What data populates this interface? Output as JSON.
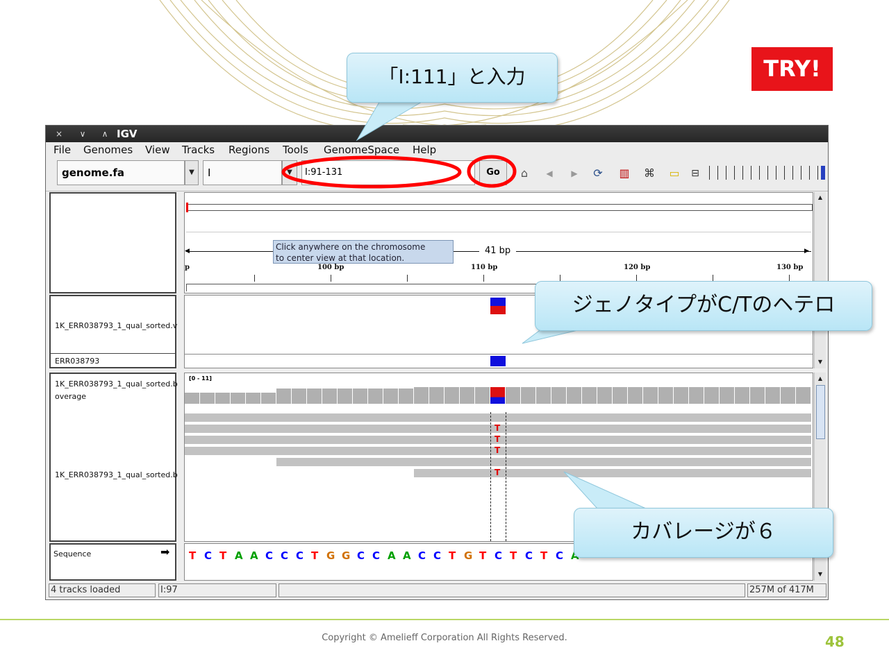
{
  "try_badge": "TRY!",
  "callouts": {
    "enter_locus": "「I:111」と入力",
    "genotype": "ジェノタイプがC/Tのヘテロ",
    "coverage": "カバレージが６"
  },
  "window": {
    "title": "IGV",
    "controls": [
      "×",
      "∨",
      "∧"
    ]
  },
  "menu": [
    "File",
    "Genomes",
    "View",
    "Tracks",
    "Regions",
    "Tools",
    "GenomeSpace",
    "Help"
  ],
  "toolbar": {
    "genome": "genome.fa",
    "chromosome": "I",
    "locus": "I:91-131",
    "go": "Go",
    "icons": [
      "home-icon",
      "back-icon",
      "forward-icon",
      "refresh-icon",
      "region-icon",
      "resize-icon",
      "popup-info-icon",
      "zoom-out-icon"
    ]
  },
  "ruler": {
    "tooltip_line1": "Click anywhere on the chromosome",
    "tooltip_line2": "to center view at that location.",
    "span": "41 bp",
    "edge_label": "p",
    "ticks": [
      "100 bp",
      "110 bp",
      "120 bp",
      "130 bp"
    ]
  },
  "tracks": {
    "vcf_name": "1K_ERR038793_1_qual_sorted.v",
    "sample_name": "ERR038793",
    "coverage_name_line1": "1K_ERR038793_1_qual_sorted.b",
    "coverage_name_line2": "overage",
    "coverage_range": "[0 - 11]",
    "alignment_name": "1K_ERR038793_1_qual_sorted.b",
    "sequence_name": "Sequence",
    "sequence_arrow": "➡"
  },
  "sequence": [
    "T",
    "C",
    "T",
    "A",
    "A",
    "C",
    "C",
    "C",
    "T",
    "G",
    "G",
    "C",
    "C",
    "A",
    "A",
    "C",
    "C",
    "T",
    "G",
    "T",
    "C",
    "T",
    "C",
    "T",
    "C",
    "A"
  ],
  "base_colors": {
    "A": "#00a000",
    "C": "#0000ff",
    "G": "#d17105",
    "T": "#ff0000"
  },
  "mismatch_base": "T",
  "status": {
    "tracks_loaded": "4 tracks loaded",
    "position": "I:97",
    "memory": "257M of 417M"
  },
  "footer": {
    "copyright": "Copyright © Amelieff Corporation All Rights Reserved.",
    "page_number": "48"
  }
}
